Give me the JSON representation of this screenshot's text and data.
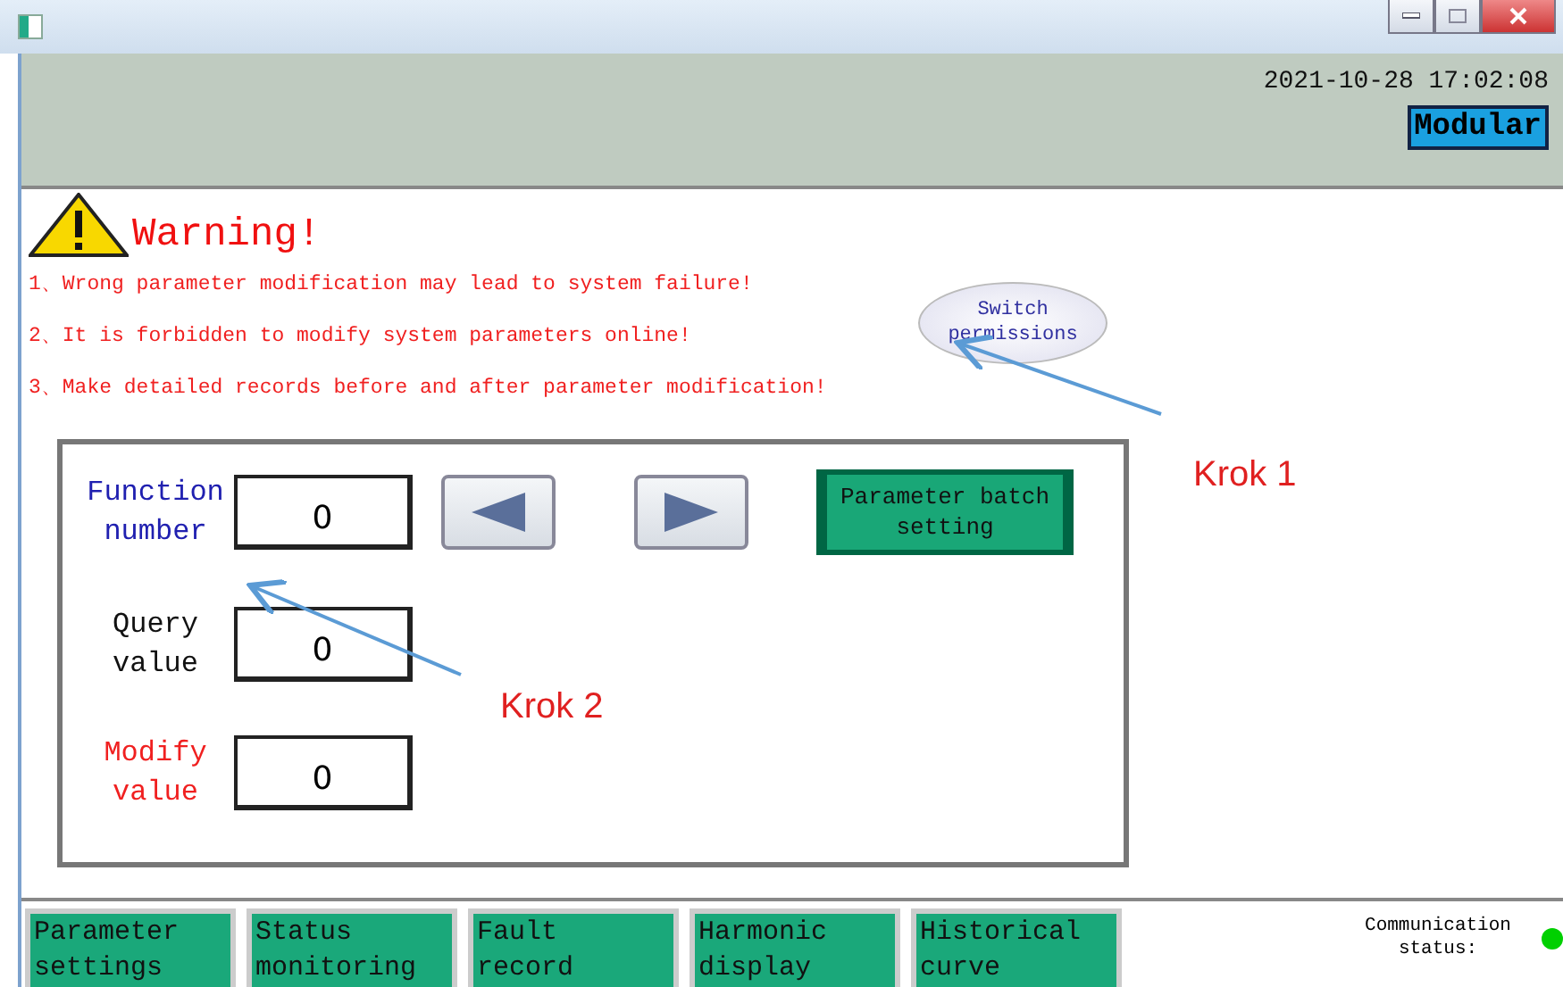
{
  "header": {
    "datetime": "2021-10-28  17:02:08",
    "mode_button": "Modular"
  },
  "warning": {
    "title": "Warning!",
    "lines": [
      "1、Wrong parameter modification may lead to system failure!",
      "2、It is forbidden to modify system parameters online!",
      "3、Make detailed records before and after parameter modification!"
    ],
    "permission_button": "Switch permissions"
  },
  "form": {
    "fields": [
      {
        "label": "Function number",
        "value": "0",
        "kind": "function"
      },
      {
        "label": "Query value",
        "value": "0",
        "kind": "query"
      },
      {
        "label": "Modify value",
        "value": "0",
        "kind": "modify"
      }
    ],
    "batch_button": "Parameter batch setting"
  },
  "tabs": [
    {
      "label": "Parameter settings",
      "selected": false
    },
    {
      "label": "Status monitoring",
      "selected": false
    },
    {
      "label": "Fault record",
      "selected": false
    },
    {
      "label": "Harmonic display",
      "selected": false
    },
    {
      "label": "Historical curve",
      "selected": false
    }
  ],
  "communication": {
    "label": "Communication status:",
    "connected": true
  },
  "annotations": [
    {
      "label": "Krok 1"
    },
    {
      "label": "Krok 2"
    }
  ]
}
